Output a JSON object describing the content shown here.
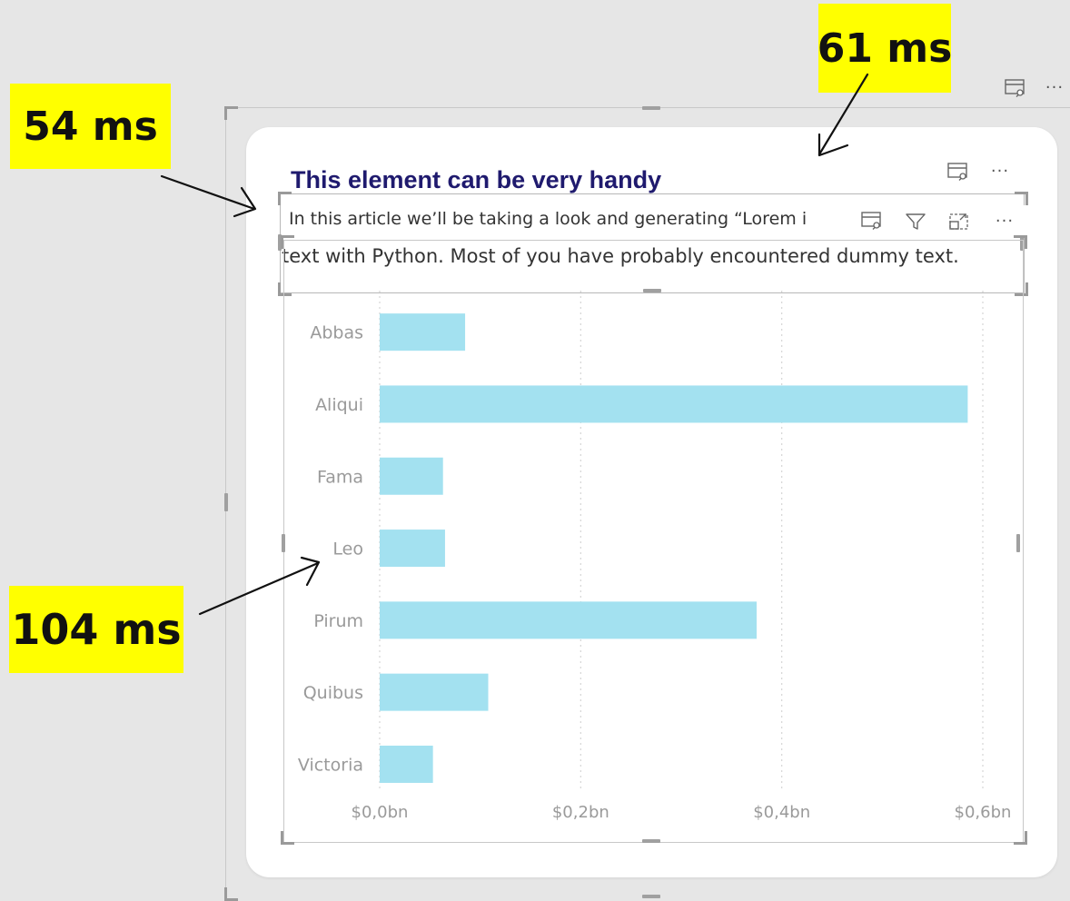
{
  "visual": {
    "title": "This element can be very handy",
    "text_line1": "In this article we’ll be taking a look and generating “Lorem i",
    "text_line2": "text with Python. Most of you have probably encountered dummy text.",
    "title_color": "#1f1a6e",
    "icons": [
      "focus-mode-icon",
      "more-options-icon",
      "filter-icon",
      "expand-icon"
    ]
  },
  "chart_data": {
    "type": "bar",
    "orientation": "horizontal",
    "categories": [
      "Abbas",
      "Aliqui",
      "Fama",
      "Leo",
      "Pirum",
      "Quibus",
      "Victoria"
    ],
    "values": [
      0.085,
      0.585,
      0.063,
      0.065,
      0.375,
      0.108,
      0.053
    ],
    "x_ticks": [
      "$0,0bn",
      "$0,2bn",
      "$0,4bn",
      "$0,6bn"
    ],
    "x_tick_values": [
      0,
      0.2,
      0.4,
      0.6
    ],
    "xlim": [
      0,
      0.6
    ],
    "grid": true,
    "bar_color": "#a3e1f0"
  },
  "annotations": [
    {
      "label": "54 ms"
    },
    {
      "label": "61 ms"
    },
    {
      "label": "104 ms"
    }
  ],
  "colors": {
    "highlight": "#ffff00",
    "background": "#e6e6e6",
    "card": "#ffffff"
  }
}
